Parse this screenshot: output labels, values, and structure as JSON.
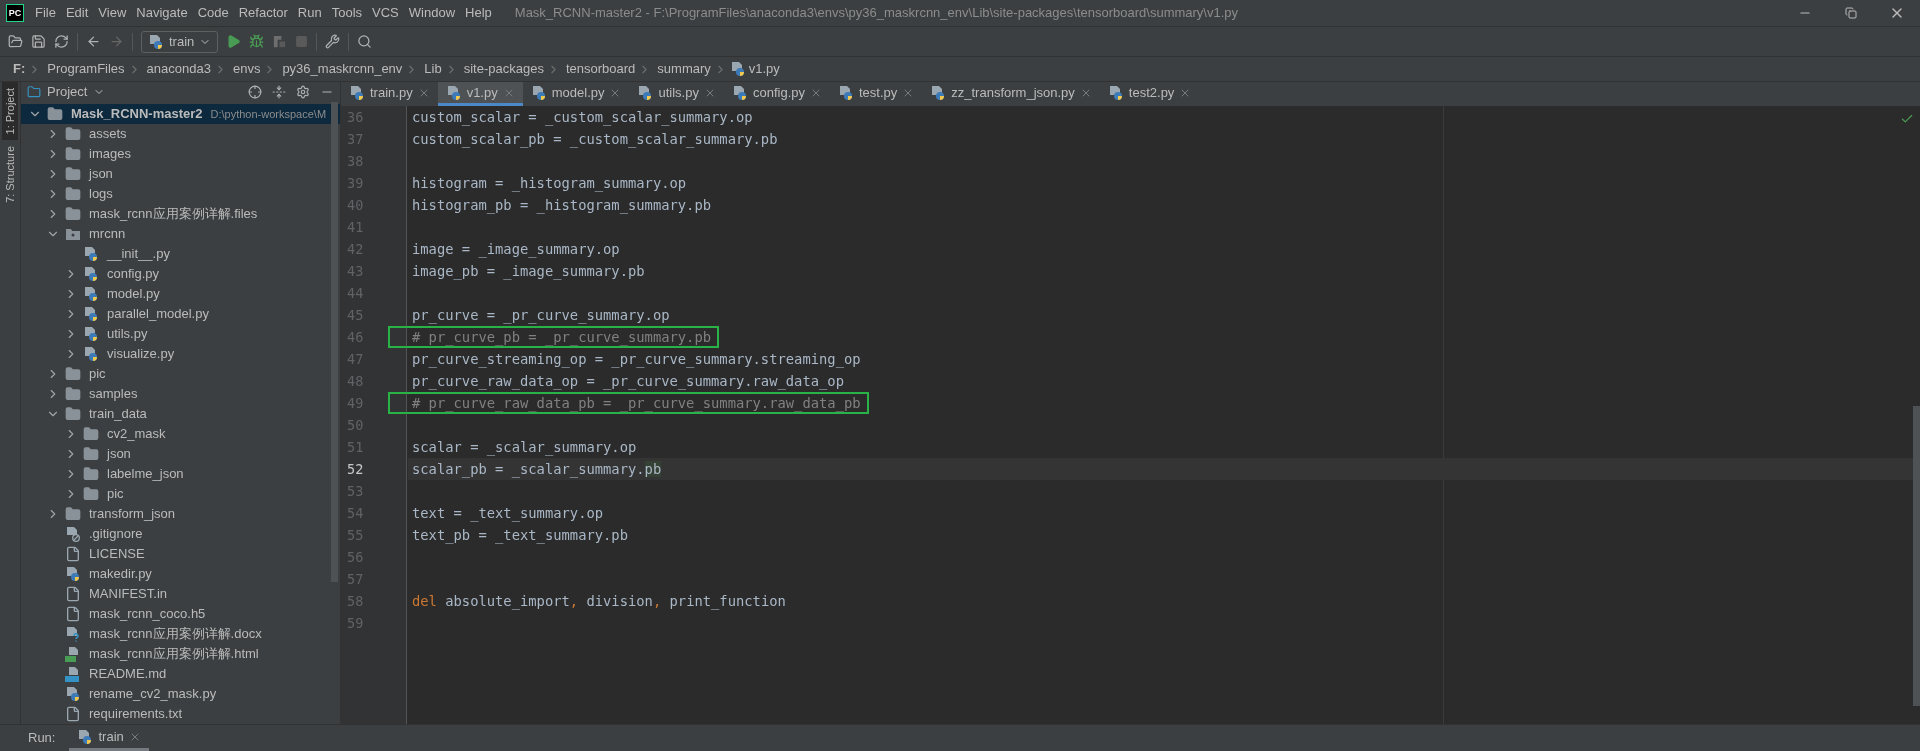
{
  "app_logo": "PC",
  "menu": [
    "File",
    "Edit",
    "View",
    "Navigate",
    "Code",
    "Refactor",
    "Run",
    "Tools",
    "VCS",
    "Window",
    "Help"
  ],
  "window": {
    "title": "Mask_RCNN-master2 - F:\\ProgramFiles\\anaconda3\\envs\\py36_maskrcnn_env\\Lib\\site-packages\\tensorboard\\summary\\v1.py"
  },
  "toolbar": {
    "run_config": "train"
  },
  "breadcrumb": [
    "F:",
    "ProgramFiles",
    "anaconda3",
    "envs",
    "py36_maskrcnn_env",
    "Lib",
    "site-packages",
    "tensorboard",
    "summary",
    "v1.py"
  ],
  "side_stripe": [
    {
      "label": "1: Project",
      "selected": true
    },
    {
      "label": "7: Structure",
      "selected": false
    }
  ],
  "project_panel": {
    "title": "Project",
    "tree": [
      {
        "name": "Mask_RCNN-master2",
        "detail": "D:\\python-workspace\\M",
        "kind": "folder",
        "expanded": true,
        "selected": true,
        "children": [
          {
            "name": "assets",
            "kind": "folder",
            "expanded": false,
            "selected": false
          },
          {
            "name": "images",
            "kind": "folder",
            "expanded": false,
            "selected": false
          },
          {
            "name": "json",
            "kind": "folder",
            "expanded": false,
            "selected": false
          },
          {
            "name": "logs",
            "kind": "folder",
            "expanded": false,
            "selected": false
          },
          {
            "name": "mask_rcnn应用案例详解.files",
            "kind": "folder",
            "expanded": false,
            "selected": false
          },
          {
            "name": "mrcnn",
            "kind": "package",
            "expanded": true,
            "selected": false,
            "children": [
              {
                "name": "__init__.py",
                "kind": "python",
                "selected": false
              },
              {
                "name": "config.py",
                "kind": "python",
                "expanded": false,
                "selected": false
              },
              {
                "name": "model.py",
                "kind": "python",
                "expanded": false,
                "selected": false
              },
              {
                "name": "parallel_model.py",
                "kind": "python",
                "expanded": false,
                "selected": false
              },
              {
                "name": "utils.py",
                "kind": "python",
                "expanded": false,
                "selected": false
              },
              {
                "name": "visualize.py",
                "kind": "python",
                "expanded": false,
                "selected": false
              }
            ]
          },
          {
            "name": "pic",
            "kind": "folder",
            "expanded": false,
            "selected": false
          },
          {
            "name": "samples",
            "kind": "folder",
            "expanded": false,
            "selected": false
          },
          {
            "name": "train_data",
            "kind": "folder",
            "expanded": true,
            "selected": false,
            "children": [
              {
                "name": "cv2_mask",
                "kind": "folder",
                "expanded": false,
                "selected": false
              },
              {
                "name": "json",
                "kind": "folder",
                "expanded": false,
                "selected": false
              },
              {
                "name": "labelme_json",
                "kind": "folder",
                "expanded": false,
                "selected": false
              },
              {
                "name": "pic",
                "kind": "folder",
                "expanded": false,
                "selected": false
              }
            ]
          },
          {
            "name": "transform_json",
            "kind": "folder",
            "expanded": false,
            "selected": false
          },
          {
            "name": ".gitignore",
            "kind": "ignore",
            "selected": false
          },
          {
            "name": "LICENSE",
            "kind": "text",
            "selected": false
          },
          {
            "name": "makedir.py",
            "kind": "python",
            "selected": false
          },
          {
            "name": "MANIFEST.in",
            "kind": "text",
            "selected": false
          },
          {
            "name": "mask_rcnn_coco.h5",
            "kind": "text",
            "selected": false
          },
          {
            "name": "mask_rcnn应用案例详解.docx",
            "kind": "unknown",
            "selected": false
          },
          {
            "name": "mask_rcnn应用案例详解.html",
            "kind": "html",
            "selected": false
          },
          {
            "name": "README.md",
            "kind": "markdown",
            "selected": false
          },
          {
            "name": "rename_cv2_mask.py",
            "kind": "python",
            "selected": false
          },
          {
            "name": "requirements.txt",
            "kind": "text",
            "selected": false
          }
        ]
      }
    ]
  },
  "tabs": [
    {
      "label": "train.py",
      "selected": false
    },
    {
      "label": "v1.py",
      "selected": true
    },
    {
      "label": "model.py",
      "selected": false
    },
    {
      "label": "utils.py",
      "selected": false
    },
    {
      "label": "config.py",
      "selected": false
    },
    {
      "label": "test.py",
      "selected": false
    },
    {
      "label": "zz_transform_json.py",
      "selected": false
    },
    {
      "label": "test2.py",
      "selected": false
    }
  ],
  "editor": {
    "lines": [
      {
        "number": "36",
        "boxed": false,
        "current": false,
        "tokens": [
          {
            "kind": "plain",
            "text": "custom_scalar = _custom_scalar_summary.op"
          }
        ]
      },
      {
        "number": "37",
        "boxed": false,
        "current": false,
        "tokens": [
          {
            "kind": "plain",
            "text": "custom_scalar_pb = _custom_scalar_summary.pb"
          }
        ]
      },
      {
        "number": "38",
        "boxed": false,
        "current": false
      },
      {
        "number": "39",
        "boxed": false,
        "current": false,
        "tokens": [
          {
            "kind": "plain",
            "text": "histogram = _histogram_summary.op"
          }
        ]
      },
      {
        "number": "40",
        "boxed": false,
        "current": false,
        "tokens": [
          {
            "kind": "plain",
            "text": "histogram_pb = _histogram_summary.pb"
          }
        ]
      },
      {
        "number": "41",
        "boxed": false,
        "current": false
      },
      {
        "number": "42",
        "boxed": false,
        "current": false,
        "tokens": [
          {
            "kind": "plain",
            "text": "image = _image_summary.op"
          }
        ]
      },
      {
        "number": "43",
        "boxed": false,
        "current": false,
        "tokens": [
          {
            "kind": "plain",
            "text": "image_pb = _image_summary.pb"
          }
        ]
      },
      {
        "number": "44",
        "boxed": false,
        "current": false
      },
      {
        "number": "45",
        "boxed": false,
        "current": false,
        "tokens": [
          {
            "kind": "plain",
            "text": "pr_curve = _pr_curve_summary.op"
          }
        ]
      },
      {
        "number": "46",
        "boxed": true,
        "current": false,
        "tokens": [
          {
            "kind": "comment",
            "text": "# pr_curve_pb = _pr_curve_summary.pb"
          }
        ]
      },
      {
        "number": "47",
        "boxed": false,
        "current": false,
        "tokens": [
          {
            "kind": "plain",
            "text": "pr_curve_streaming_op = _pr_curve_summary.streaming_op"
          }
        ]
      },
      {
        "number": "48",
        "boxed": false,
        "current": false,
        "tokens": [
          {
            "kind": "plain",
            "text": "pr_curve_raw_data_op = _pr_curve_summary.raw_data_op"
          }
        ]
      },
      {
        "number": "49",
        "boxed": true,
        "current": false,
        "tokens": [
          {
            "kind": "comment",
            "text": "# pr_curve_raw_data_pb = _pr_curve_summary.raw_data_pb"
          }
        ]
      },
      {
        "number": "50",
        "boxed": false,
        "current": false
      },
      {
        "number": "51",
        "boxed": false,
        "current": false,
        "tokens": [
          {
            "kind": "plain",
            "text": "scalar = _scalar_summary.op"
          }
        ]
      },
      {
        "number": "52",
        "boxed": false,
        "current": true,
        "tokens": [
          {
            "kind": "plain",
            "text": "scalar_pb = _scalar_summary."
          },
          {
            "kind": "match",
            "text": "pb"
          }
        ]
      },
      {
        "number": "53",
        "boxed": false,
        "current": false
      },
      {
        "number": "54",
        "boxed": false,
        "current": false,
        "tokens": [
          {
            "kind": "plain",
            "text": "text = _text_summary.op"
          }
        ]
      },
      {
        "number": "55",
        "boxed": false,
        "current": false,
        "tokens": [
          {
            "kind": "plain",
            "text": "text_pb = _text_summary.pb"
          }
        ]
      },
      {
        "number": "56",
        "boxed": false,
        "current": false
      },
      {
        "number": "57",
        "boxed": false,
        "current": false
      },
      {
        "number": "58",
        "boxed": false,
        "current": false,
        "tokens": [
          {
            "kind": "keyword",
            "text": "del"
          },
          {
            "kind": "plain",
            "text": " absolute_import"
          },
          {
            "kind": "punct",
            "text": ","
          },
          {
            "kind": "plain",
            "text": " division"
          },
          {
            "kind": "punct",
            "text": ","
          },
          {
            "kind": "plain",
            "text": " print_function"
          }
        ]
      },
      {
        "number": "59",
        "boxed": false,
        "current": false
      }
    ]
  },
  "run_bar": {
    "label": "Run:",
    "tab": "train"
  }
}
